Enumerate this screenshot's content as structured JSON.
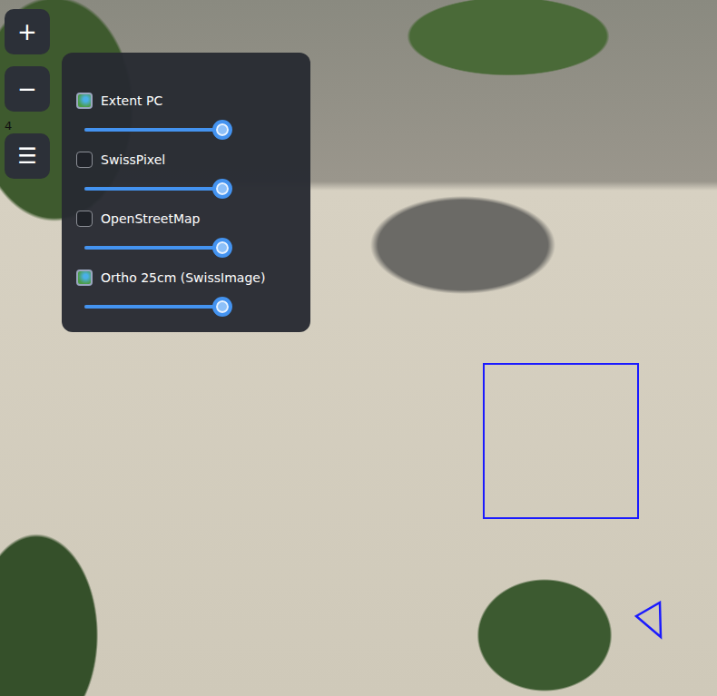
{
  "zoom_controls": {
    "zoom_in": "+",
    "zoom_out": "−",
    "zoom_level": "4"
  },
  "menu_button": "☰",
  "layers": [
    {
      "label": "Extent PC",
      "checked": true,
      "level": 1
    },
    {
      "label": "SwissPixel",
      "checked": false,
      "level": 1
    },
    {
      "label": "OpenStreetMap",
      "checked": false,
      "level": 1
    },
    {
      "label": "Ortho 25cm (SwissImage)",
      "checked": true,
      "level": 1
    }
  ]
}
